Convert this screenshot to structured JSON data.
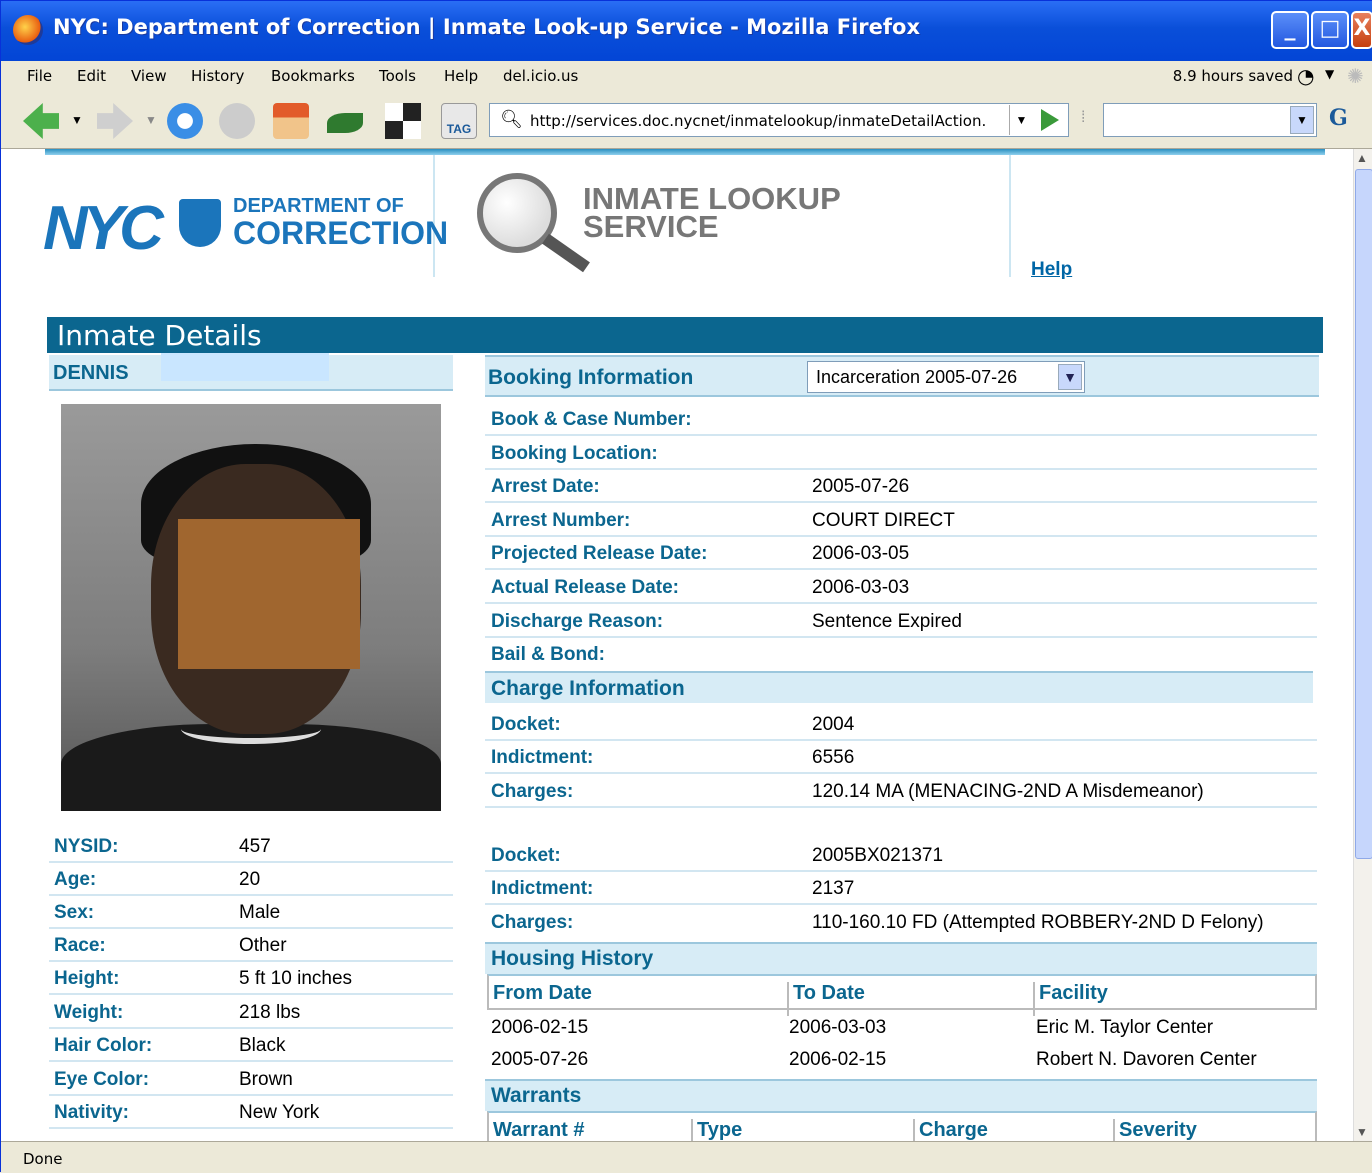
{
  "window": {
    "title": "NYC: Department of Correction | Inmate Look-up Service - Mozilla Firefox",
    "minimize": "_",
    "maximize": "□",
    "close": "X"
  },
  "menu": [
    "File",
    "Edit",
    "View",
    "History",
    "Bookmarks",
    "Tools",
    "Help",
    "del.icio.us"
  ],
  "saved": "8.9 hours saved",
  "toolbar": {
    "tag": "TAG",
    "url": "http://services.doc.nycnet/inmatelookup/inmateDetailAction.",
    "search_placeholder": "",
    "search_engine": "G"
  },
  "header": {
    "logo_nyc": "NYC",
    "dept_line1": "DEPARTMENT OF",
    "dept_line2": "CORRECTION",
    "service_line1": "INMATE LOOKUP",
    "service_line2": "SERVICE",
    "help": "Help"
  },
  "section_title": "Inmate Details",
  "inmate": {
    "name": "DENNIS",
    "details": [
      {
        "label": "NYSID:",
        "value": "457"
      },
      {
        "label": "Age:",
        "value": "20"
      },
      {
        "label": "Sex:",
        "value": "Male"
      },
      {
        "label": "Race:",
        "value": "Other"
      },
      {
        "label": "Height:",
        "value": "5 ft  10 inches"
      },
      {
        "label": "Weight:",
        "value": "218 lbs"
      },
      {
        "label": "Hair Color:",
        "value": "Black"
      },
      {
        "label": "Eye Color:",
        "value": "Brown"
      },
      {
        "label": "Nativity:",
        "value": "New York"
      }
    ]
  },
  "booking": {
    "title": "Booking Information",
    "selected": "Incarceration 2005-07-26",
    "rows": [
      {
        "label": "Book & Case Number:",
        "value": ""
      },
      {
        "label": "Booking Location:",
        "value": ""
      },
      {
        "label": "Arrest Date:",
        "value": "2005-07-26"
      },
      {
        "label": "Arrest Number:",
        "value": "COURT DIRECT"
      },
      {
        "label": "Projected Release Date:",
        "value": "2006-03-05"
      },
      {
        "label": "Actual Release Date:",
        "value": "2006-03-03"
      },
      {
        "label": "Discharge Reason:",
        "value": "Sentence Expired"
      },
      {
        "label": "Bail & Bond:",
        "value": ""
      }
    ]
  },
  "charges": {
    "title": "Charge Information",
    "groups": [
      [
        {
          "label": "Docket:",
          "value": "2004"
        },
        {
          "label": "Indictment:",
          "value": "6556"
        },
        {
          "label": "Charges:",
          "value": "120.14 MA (MENACING-2ND A Misdemeanor)"
        }
      ],
      [
        {
          "label": "Docket:",
          "value": "2005BX021371"
        },
        {
          "label": "Indictment:",
          "value": "2137"
        },
        {
          "label": "Charges:",
          "value": "110-160.10 FD (Attempted ROBBERY-2ND D Felony)"
        }
      ]
    ]
  },
  "housing": {
    "title": "Housing History",
    "columns": [
      "From Date",
      "To Date",
      "Facility"
    ],
    "rows": [
      [
        "2006-02-15",
        "2006-03-03",
        "Eric M. Taylor Center"
      ],
      [
        "2005-07-26",
        "2006-02-15",
        "Robert N. Davoren Center"
      ]
    ]
  },
  "warrants": {
    "title": "Warrants",
    "columns": [
      "Warrant #",
      "Type",
      "Charge",
      "Severity"
    ]
  },
  "status": "Done"
}
